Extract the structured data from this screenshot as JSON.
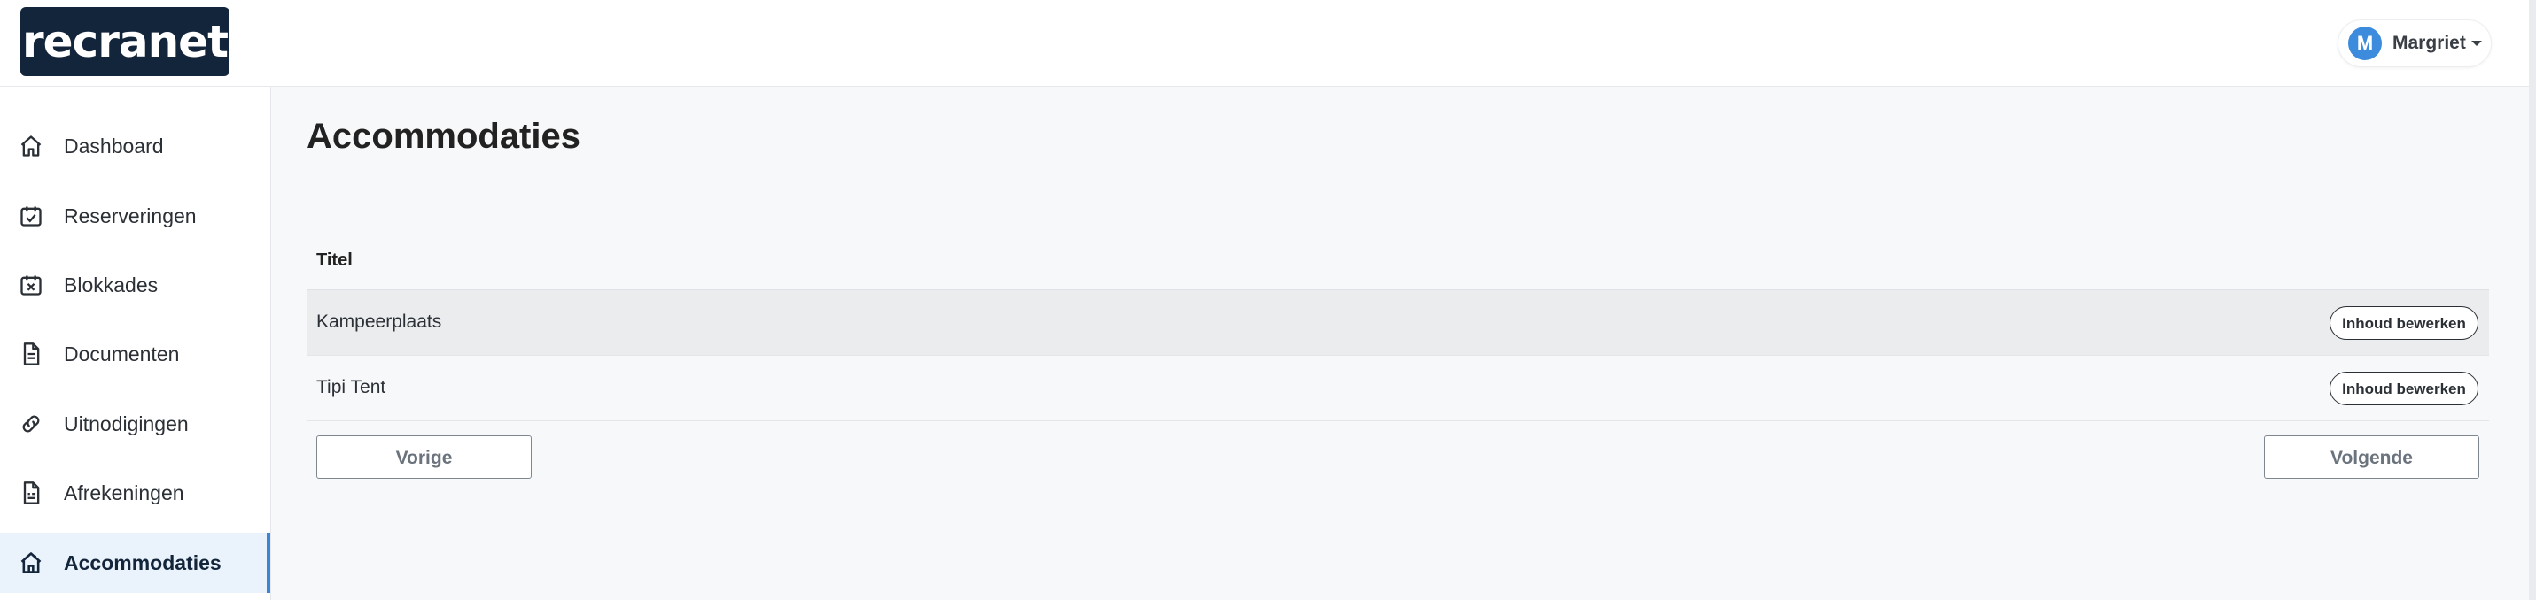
{
  "header": {
    "logo_text": "recranet",
    "user": {
      "initial": "M",
      "name": "Margriet"
    }
  },
  "sidebar": {
    "items": [
      {
        "label": "Dashboard",
        "icon": "home-icon"
      },
      {
        "label": "Reserveringen",
        "icon": "calendar-check-icon"
      },
      {
        "label": "Blokkades",
        "icon": "calendar-x-icon"
      },
      {
        "label": "Documenten",
        "icon": "document-icon"
      },
      {
        "label": "Uitnodigingen",
        "icon": "link-icon"
      },
      {
        "label": "Afrekeningen",
        "icon": "receipt-icon"
      },
      {
        "label": "Accommodaties",
        "icon": "house-icon",
        "active": true
      }
    ]
  },
  "main": {
    "title": "Accommodaties",
    "table": {
      "column_header": "Titel",
      "rows": [
        {
          "title": "Kampeerplaats",
          "action": "Inhoud bewerken"
        },
        {
          "title": "Tipi Tent",
          "action": "Inhoud bewerken"
        }
      ]
    },
    "pagination": {
      "prev": "Vorige",
      "next": "Volgende"
    }
  },
  "colors": {
    "logo_bg": "#13253a",
    "accent": "#3a86d4",
    "active_bg": "#eaf2fb",
    "hover_row_bg": "#ebecee",
    "page_bg": "#f7f8fa"
  }
}
